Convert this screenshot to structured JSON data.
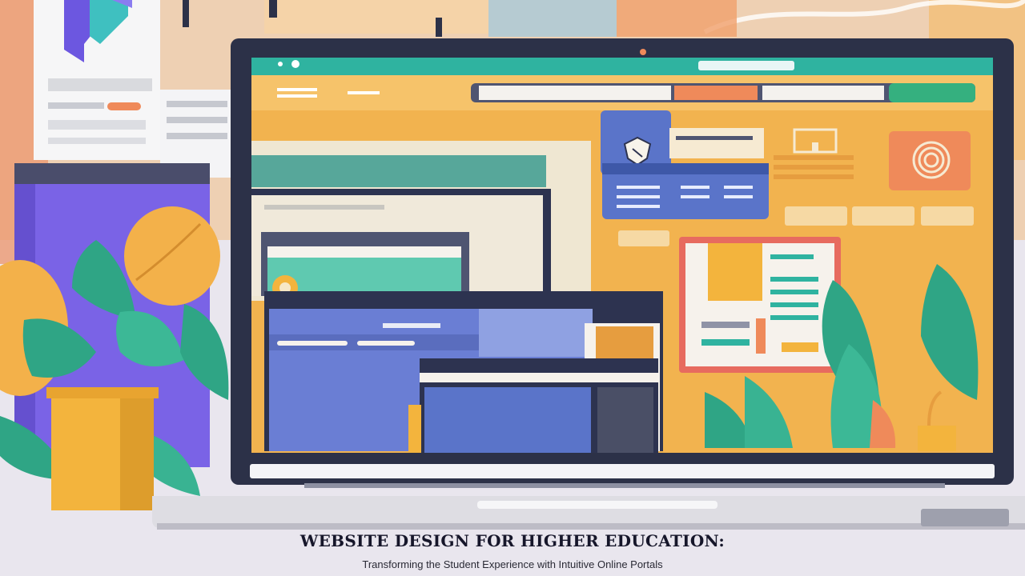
{
  "caption": {
    "title": "WEBSITE DESIGN FOR HIGHER EDUCATION:",
    "subtitle": "Transforming the Student Experience with Intuitive Online Portals"
  },
  "colors": {
    "screen_bg": "#f2b34f",
    "laptop_bezel": "#2c3148",
    "browser_bar": "#2fb3a0",
    "purple": "#7a63e6",
    "accent_orange": "#ef8a5a",
    "accent_blue": "#5a74c9",
    "plant_green": "#2fa585",
    "pot_yellow": "#f3b43d"
  },
  "icons": {
    "logo": "education-logo-icon",
    "shield": "shield-crest-icon",
    "fingerprint": "fingerprint-icon",
    "frame": "frame-icon"
  }
}
